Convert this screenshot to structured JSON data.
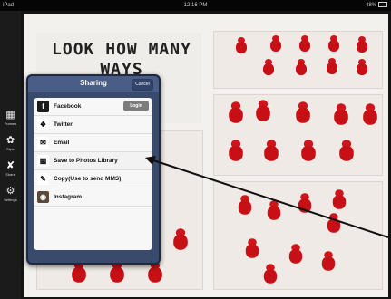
{
  "status_bar": {
    "device": "iPad",
    "time": "12:16 PM",
    "battery": "48%"
  },
  "sidebar": {
    "items": [
      {
        "label": "Frames",
        "icon": "grid-icon"
      },
      {
        "label": "Style",
        "icon": "palette-icon"
      },
      {
        "label": "Share",
        "icon": "share-icon",
        "active": true
      },
      {
        "label": "Settings",
        "icon": "gear-icon"
      }
    ]
  },
  "canvas": {
    "title_text": "LOOK HOW MANY WAYS"
  },
  "sharing_popup": {
    "title": "Sharing",
    "cancel_label": "Cancel",
    "items": [
      {
        "label": "Facebook",
        "icon": "facebook-icon",
        "action": "Login"
      },
      {
        "label": "Twitter",
        "icon": "twitter-icon"
      },
      {
        "label": "Email",
        "icon": "email-icon"
      },
      {
        "label": "Save to Photos Library",
        "icon": "folder-icon"
      },
      {
        "label": "Copy(Use to send MMS)",
        "icon": "copy-icon"
      },
      {
        "label": "Instagram",
        "icon": "instagram-icon"
      }
    ]
  }
}
